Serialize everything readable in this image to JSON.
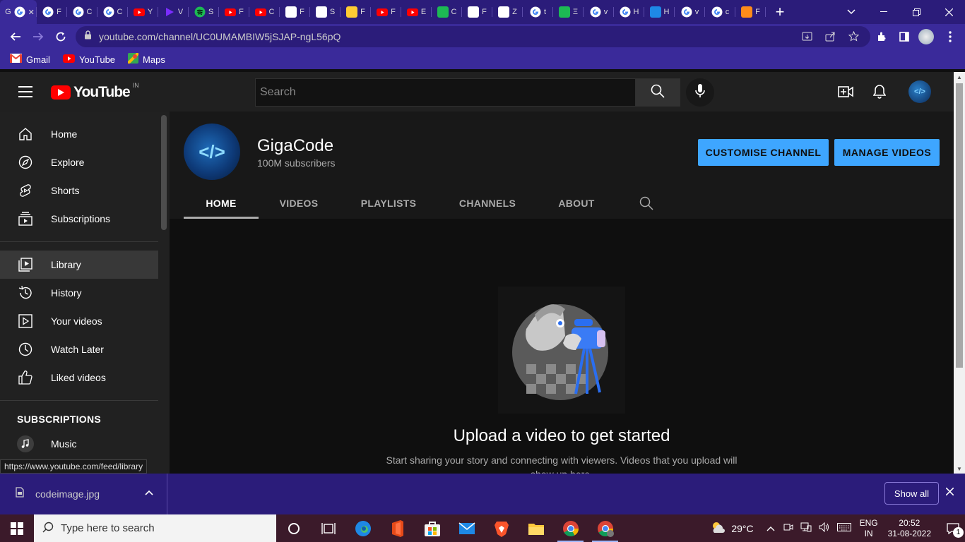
{
  "browser": {
    "tabs": [
      {
        "label": "G",
        "icon": "google-icon",
        "color": "#ffffff",
        "active": true
      },
      {
        "label": "F",
        "icon": "google-icon",
        "color": "#ffffff"
      },
      {
        "label": "C",
        "icon": "google-icon",
        "color": "#ffffff"
      },
      {
        "label": "C",
        "icon": "google-icon",
        "color": "#ffffff"
      },
      {
        "label": "Y",
        "icon": "youtube-icon",
        "color": "#ff0000"
      },
      {
        "label": "V",
        "icon": "video-icon",
        "color": "#7b2cff"
      },
      {
        "label": "S",
        "icon": "spotify-icon",
        "color": "#1db954"
      },
      {
        "label": "F",
        "icon": "youtube-icon",
        "color": "#ff0000"
      },
      {
        "label": "C",
        "icon": "youtube-icon",
        "color": "#ff0000"
      },
      {
        "label": "F",
        "icon": "zb-icon",
        "color": "#ffffff"
      },
      {
        "label": "S",
        "icon": "s-square-icon",
        "color": "#ffffff"
      },
      {
        "label": "F",
        "icon": "emoji-icon",
        "color": "#ffcc33"
      },
      {
        "label": "F",
        "icon": "youtube-icon",
        "color": "#ff0000"
      },
      {
        "label": "E",
        "icon": "youtube-icon",
        "color": "#ff0000"
      },
      {
        "label": "C",
        "icon": "w-icon",
        "color": "#1db954"
      },
      {
        "label": "F",
        "icon": "zb-icon",
        "color": "#ffffff"
      },
      {
        "label": "Z",
        "icon": "f-square-icon",
        "color": "#ffffff"
      },
      {
        "label": "t",
        "icon": "google-icon",
        "color": "#ffffff"
      },
      {
        "label": "Ξ",
        "icon": "q-icon",
        "color": "#1db954"
      },
      {
        "label": "v",
        "icon": "google-icon",
        "color": "#ffffff"
      },
      {
        "label": "H",
        "icon": "google-icon",
        "color": "#ffffff"
      },
      {
        "label": "H",
        "icon": "ef-icon",
        "color": "#1e88e5"
      },
      {
        "label": "v",
        "icon": "google-icon",
        "color": "#ffffff"
      },
      {
        "label": "c",
        "icon": "google-icon",
        "color": "#ffffff"
      },
      {
        "label": "F",
        "icon": "orange-icon",
        "color": "#ff8c1a"
      }
    ],
    "url": "youtube.com/channel/UC0UMAMBIW5jSJAP-ngL56pQ",
    "bookmarks": [
      {
        "label": "Gmail",
        "icon": "gmail-icon"
      },
      {
        "label": "YouTube",
        "icon": "youtube-icon"
      },
      {
        "label": "Maps",
        "icon": "maps-icon"
      }
    ]
  },
  "youtube": {
    "logo_text": "YouTube",
    "country_code": "IN",
    "search_placeholder": "Search",
    "sidebar": {
      "main": [
        {
          "label": "Home",
          "icon": "home-icon"
        },
        {
          "label": "Explore",
          "icon": "compass-icon"
        },
        {
          "label": "Shorts",
          "icon": "shorts-icon"
        },
        {
          "label": "Subscriptions",
          "icon": "subscriptions-icon"
        }
      ],
      "library": [
        {
          "label": "Library",
          "icon": "library-icon",
          "active": true
        },
        {
          "label": "History",
          "icon": "history-icon"
        },
        {
          "label": "Your videos",
          "icon": "your-videos-icon"
        },
        {
          "label": "Watch Later",
          "icon": "clock-icon"
        },
        {
          "label": "Liked videos",
          "icon": "thumbs-up-icon"
        }
      ],
      "subscriptions_heading": "SUBSCRIPTIONS",
      "subscriptions": [
        {
          "label": "Music",
          "icon": "music-icon"
        }
      ]
    },
    "channel": {
      "name": "GigaCode",
      "subscribers": "100M subscribers",
      "customise_label": "CUSTOMISE CHANNEL",
      "manage_label": "MANAGE VIDEOS",
      "tabs": [
        "HOME",
        "VIDEOS",
        "PLAYLISTS",
        "CHANNELS",
        "ABOUT"
      ],
      "active_tab": "HOME"
    },
    "empty_state": {
      "title": "Upload a video to get started",
      "description": "Start sharing your story and connecting with viewers. Videos that you upload will show up here."
    }
  },
  "status_link": "https://www.youtube.com/feed/library",
  "downloads": {
    "file_name": "codeimage.jpg",
    "show_all_label": "Show all"
  },
  "taskbar": {
    "search_placeholder": "Type here to search",
    "weather": "29°C",
    "language": "ENG",
    "region": "IN",
    "time": "20:52",
    "date": "31-08-2022",
    "notification_count": "1"
  },
  "colors": {
    "browser_frame": "#2b1c7a",
    "yt_accent_blue": "#3ea6ff",
    "yt_red": "#ff0000"
  }
}
